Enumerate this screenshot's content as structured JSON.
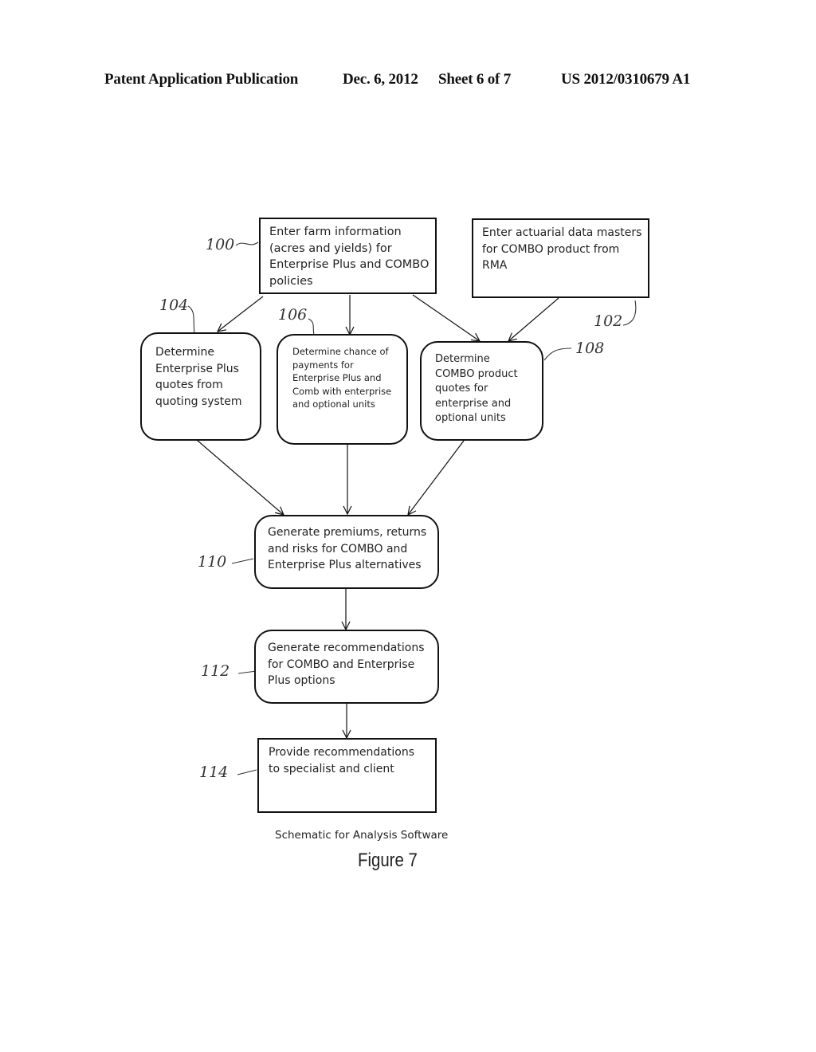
{
  "header": {
    "publication": "Patent Application Publication",
    "date": "Dec. 6, 2012",
    "sheet": "Sheet 6 of 7",
    "number": "US 2012/0310679 A1"
  },
  "nodes": {
    "n100": {
      "ref": "100",
      "text": "Enter farm information\n(acres and yields) for\nEnterprise Plus and COMBO\npolicies",
      "shape": "rectangle"
    },
    "n102": {
      "ref": "102",
      "text": "Enter actuarial data masters\nfor COMBO product from\nRMA",
      "shape": "rectangle"
    },
    "n104": {
      "ref": "104",
      "text": "Determine\nEnterprise Plus\nquotes from\nquoting system",
      "shape": "rounded"
    },
    "n106": {
      "ref": "106",
      "text": "Determine chance of\npayments for\nEnterprise Plus and\nComb with enterprise\nand optional units",
      "shape": "rounded"
    },
    "n108": {
      "ref": "108",
      "text": "Determine\nCOMBO product\nquotes for\nenterprise and\noptional units",
      "shape": "rounded"
    },
    "n110": {
      "ref": "110",
      "text": "Generate premiums, returns\nand risks for COMBO and\nEnterprise Plus alternatives",
      "shape": "rounded"
    },
    "n112": {
      "ref": "112",
      "text": "Generate recommendations\nfor COMBO and Enterprise\nPlus options",
      "shape": "rounded"
    },
    "n114": {
      "ref": "114",
      "text": "Provide recommendations\nto specialist and client",
      "shape": "rectangle"
    }
  },
  "edges": [
    {
      "from": "100",
      "to": "104"
    },
    {
      "from": "100",
      "to": "106"
    },
    {
      "from": "100",
      "to": "108"
    },
    {
      "from": "102",
      "to": "108"
    },
    {
      "from": "104",
      "to": "110"
    },
    {
      "from": "106",
      "to": "110"
    },
    {
      "from": "108",
      "to": "110"
    },
    {
      "from": "110",
      "to": "112"
    },
    {
      "from": "112",
      "to": "114"
    }
  ],
  "caption": "Schematic for Analysis Software",
  "figure_label": "Figure 7"
}
